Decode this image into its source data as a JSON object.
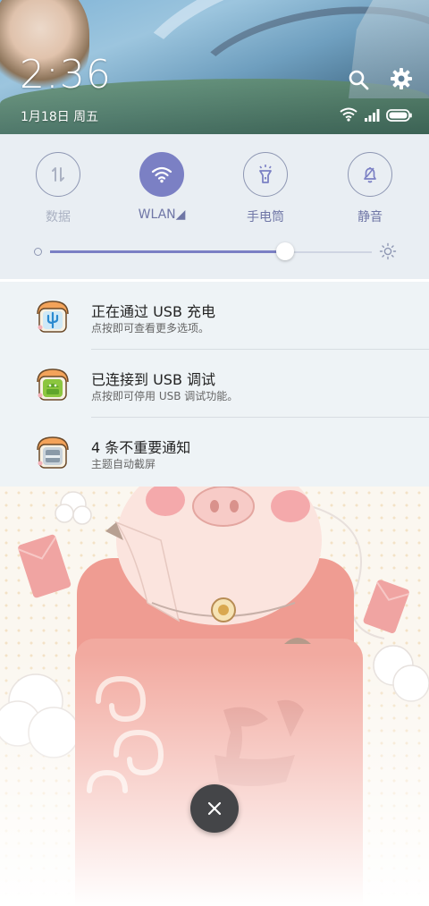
{
  "status": {
    "time": "2:36",
    "date": "1月18日 周五"
  },
  "quick_settings": {
    "tiles": [
      {
        "label": "数据",
        "state": "off"
      },
      {
        "label": "WLAN◢",
        "state": "on"
      },
      {
        "label": "手电筒",
        "state": "available"
      },
      {
        "label": "静音",
        "state": "available"
      }
    ],
    "brightness_fraction": 0.73
  },
  "notifications": [
    {
      "title": "正在通过 USB 充电",
      "subtitle": "点按即可查看更多选项。",
      "icon": "usb-charge-icon"
    },
    {
      "title": "已连接到 USB 调试",
      "subtitle": "点按即可停用 USB 调试功能。",
      "icon": "android-debug-icon"
    },
    {
      "title": "4 条不重要通知",
      "subtitle": "主题自动截屏",
      "icon": "screenshot-icon"
    }
  ],
  "colors": {
    "accent": "#7b80c4",
    "panel_bg": "#e9eef3",
    "notif_bg": "#eef3f6",
    "close_button": "#444548"
  }
}
